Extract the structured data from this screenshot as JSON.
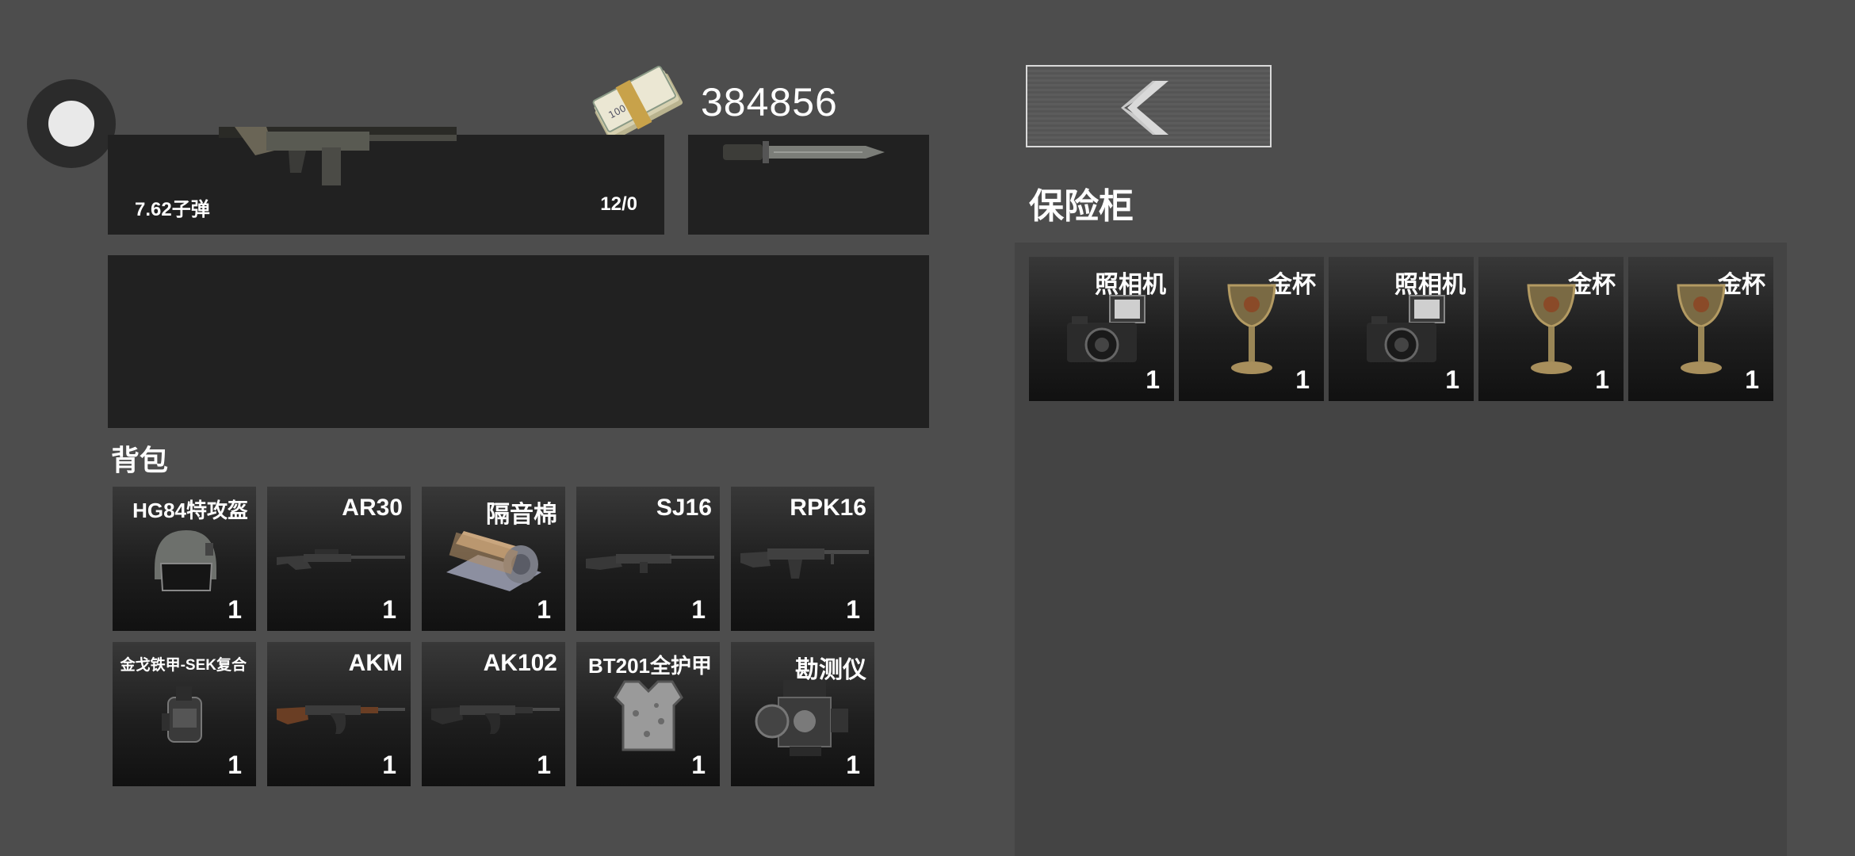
{
  "hud": {
    "money": "384856",
    "cash_icon": "cash-stack-icon",
    "joystick_icon": "joystick-icon"
  },
  "weapon": {
    "primary_ammo_label": "7.62子弹",
    "primary_ammo_count": "12/0",
    "primary_icon": "rifle-icon",
    "secondary_icon": "bayonet-knife-icon"
  },
  "backpack": {
    "title": "背包",
    "items": [
      {
        "name": "HG84特攻盔",
        "qty": "1",
        "icon": "helmet-icon"
      },
      {
        "name": "AR30",
        "qty": "1",
        "icon": "sniper-rifle-icon"
      },
      {
        "name": "隔音棉",
        "qty": "1",
        "icon": "foam-roll-icon"
      },
      {
        "name": "SJ16",
        "qty": "1",
        "icon": "rifle-icon"
      },
      {
        "name": "RPK16",
        "qty": "1",
        "icon": "machine-gun-icon"
      },
      {
        "name": "金戈铁甲-SEK复合",
        "qty": "1",
        "icon": "armor-vest-icon"
      },
      {
        "name": "AKM",
        "qty": "1",
        "icon": "ak-rifle-icon"
      },
      {
        "name": "AK102",
        "qty": "1",
        "icon": "ak-rifle-icon"
      },
      {
        "name": "BT201全护甲",
        "qty": "1",
        "icon": "body-armor-icon"
      },
      {
        "name": "勘测仪",
        "qty": "1",
        "icon": "survey-instrument-icon"
      }
    ]
  },
  "safe": {
    "title": "保险柜",
    "back_icon": "chevron-left-icon",
    "items": [
      {
        "name": "照相机",
        "qty": "1",
        "icon": "camera-icon"
      },
      {
        "name": "金杯",
        "qty": "1",
        "icon": "golden-cup-icon"
      },
      {
        "name": "照相机",
        "qty": "1",
        "icon": "camera-icon"
      },
      {
        "name": "金杯",
        "qty": "1",
        "icon": "golden-cup-icon"
      },
      {
        "name": "金杯",
        "qty": "1",
        "icon": "golden-cup-icon"
      }
    ]
  },
  "colors": {
    "background": "#4d4d4d",
    "panel": "#212121",
    "safe_panel": "#444444",
    "text": "#ffffff"
  }
}
